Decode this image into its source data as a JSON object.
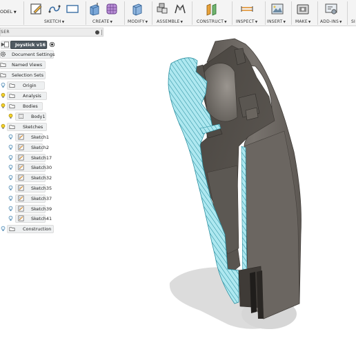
{
  "toolbar": {
    "mode_label": "ODEL",
    "groups": [
      {
        "label": "SKETCH"
      },
      {
        "label": "CREATE"
      },
      {
        "label": "MODIFY"
      },
      {
        "label": "ASSEMBLE"
      },
      {
        "label": "CONSTRUCT"
      },
      {
        "label": "INSPECT"
      },
      {
        "label": "INSERT"
      },
      {
        "label": "MAKE"
      },
      {
        "label": "ADD-INS"
      },
      {
        "label": "SI"
      }
    ]
  },
  "browser": {
    "title": "SER",
    "root": {
      "label": "Joystick v16"
    },
    "items": [
      {
        "label": "Document Settings"
      },
      {
        "label": "Named Views"
      },
      {
        "label": "Selection Sets"
      },
      {
        "label": "Origin"
      },
      {
        "label": "Analysis"
      },
      {
        "label": "Bodies"
      },
      {
        "label": "Body1"
      },
      {
        "label": "Sketches"
      },
      {
        "label": "Sketch1"
      },
      {
        "label": "Sketch2"
      },
      {
        "label": "Sketch17"
      },
      {
        "label": "Sketch30"
      },
      {
        "label": "Sketch32"
      },
      {
        "label": "Sketch35"
      },
      {
        "label": "Sketch37"
      },
      {
        "label": "Sketch39"
      },
      {
        "label": "Sketch41"
      },
      {
        "label": "Construction"
      }
    ]
  },
  "colors": {
    "section_fill": "#aee8f0",
    "section_hatch": "#2a8fa0",
    "body_dark": "#5a5550",
    "body_mid": "#6e6964",
    "body_light": "#817c77",
    "shadow": "#dedede",
    "active_pill": "#505a62"
  }
}
